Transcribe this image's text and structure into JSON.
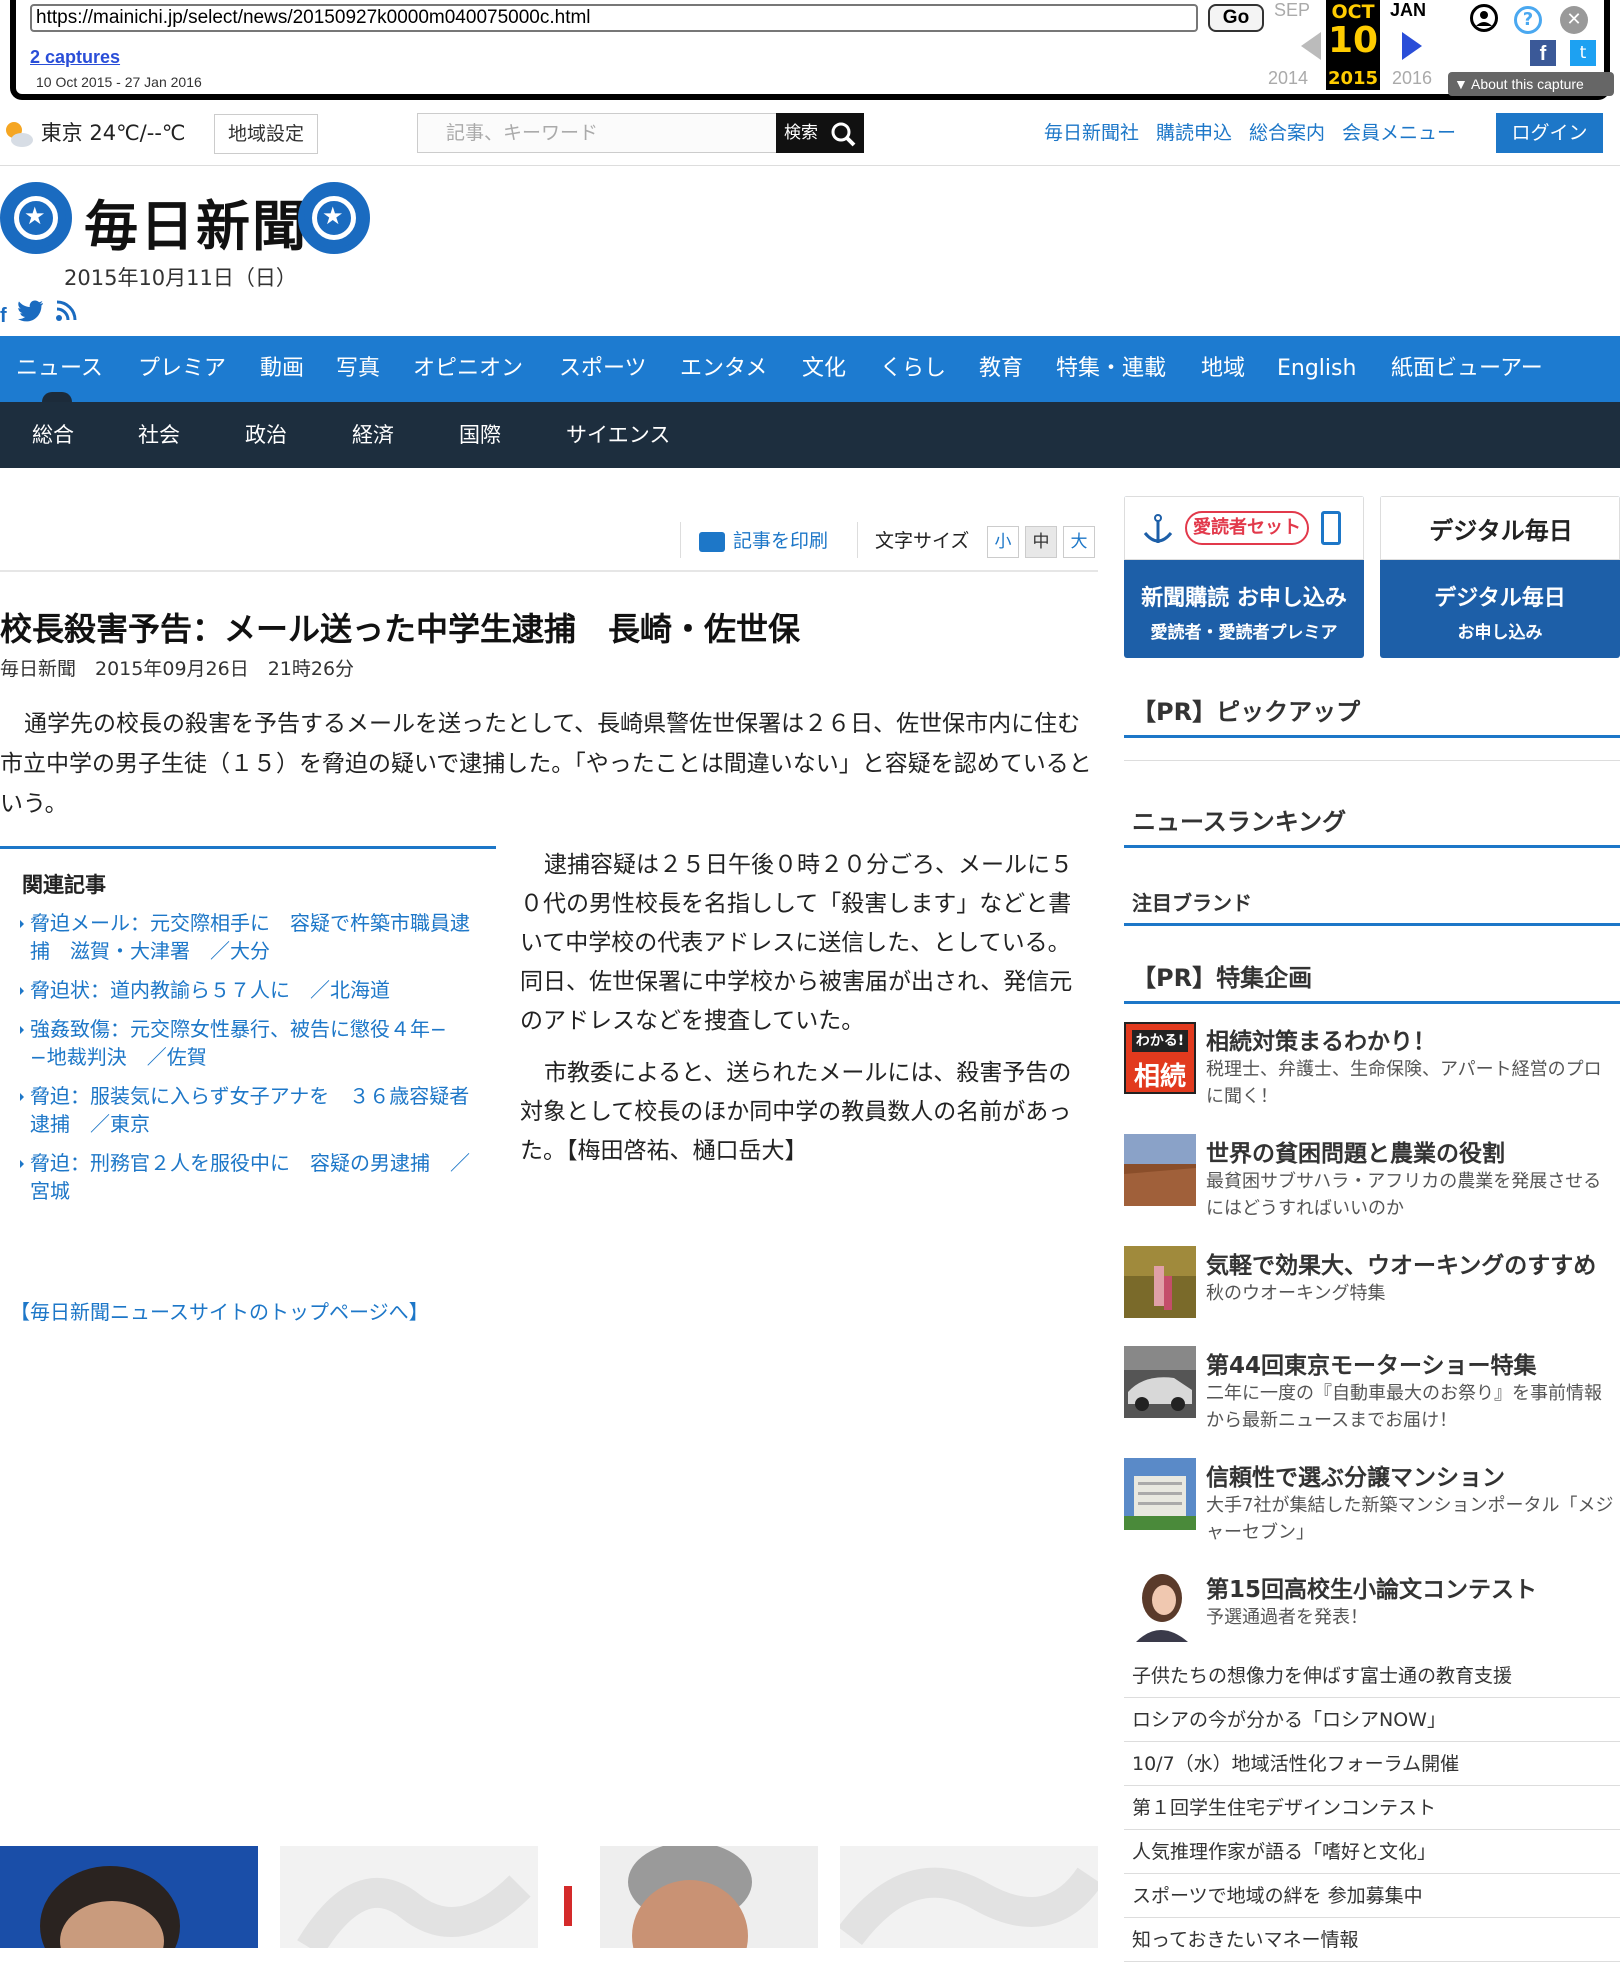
{
  "wayback": {
    "url": "https://mainichi.jp/select/news/20150927k0000m040075000c.html",
    "go_label": "Go",
    "captures_label": "2 captures",
    "range": "10 Oct 2015 - 27 Jan 2016",
    "prev_month": "SEP",
    "prev_year": "2014",
    "cur_month": "OCT",
    "cur_day": "10",
    "cur_year": "2015",
    "next_month": "JAN",
    "next_year": "2016",
    "about_label": "About this capture"
  },
  "topbar": {
    "weather": "東京 24℃/--℃",
    "region_button": "地域設定",
    "search_placeholder": "記事、キーワード",
    "search_button": "検索",
    "links": [
      "毎日新聞社",
      "購読申込",
      "総合案内",
      "会員メニュー"
    ],
    "login": "ログイン"
  },
  "brand": {
    "name": "毎日新聞",
    "date": "2015年10月11日（日）"
  },
  "nav": {
    "items": [
      "ニュース",
      "プレミア",
      "動画",
      "写真",
      "オピニオン",
      "スポーツ",
      "エンタメ",
      "文化",
      "くらし",
      "教育",
      "特集・連載",
      "地域",
      "English",
      "紙面ビューアー"
    ],
    "subitems": [
      "総合",
      "社会",
      "政治",
      "経済",
      "国際",
      "サイエンス"
    ]
  },
  "tools": {
    "print": "記事を印刷",
    "font_size_label": "文字サイズ",
    "sizes": [
      "小",
      "中",
      "大"
    ]
  },
  "article": {
    "title": "校長殺害予告：メール送った中学生逮捕　長崎・佐世保",
    "byline": "毎日新聞　2015年09月26日　21時26分",
    "lead": "通学先の校長の殺害を予告するメールを送ったとして、長崎県警佐世保署は２６日、佐世保市内に住む市立中学の男子生徒（１５）を脅迫の疑いで逮捕した。「やったことは間違いない」と容疑を認めているという。",
    "paragraphs": [
      "逮捕容疑は２５日午後０時２０分ごろ、メールに５０代の男性校長を名指しして「殺害します」などと書いて中学校の代表アドレスに送信した、としている。同日、佐世保署に中学校から被害届が出され、発信元のアドレスなどを捜査していた。",
      "市教委によると、送られたメールには、殺害予告の対象として校長のほか同中学の教員数人の名前があった。【梅田啓祐、樋口岳大】"
    ],
    "related_heading": "関連記事",
    "related": [
      "脅迫メール：元交際相手に　容疑で杵築市職員逮捕　滋賀・大津署　／大分",
      "脅迫状：道内教諭ら５７人に　／北海道",
      "強姦致傷：元交際女性暴行、被告に懲役４年−−地裁判決　／佐賀",
      "脅迫：服装気に入らず女子アナを　３６歳容疑者逮捕　／東京",
      "脅迫：刑務官２人を服役中に　容疑の男逮捕　／宮城"
    ],
    "top_link": "【毎日新聞ニュースサイトのトップページへ】"
  },
  "sidebar": {
    "banner1_top": "愛読者セット",
    "banner1_title": "新聞購読 お申し込み",
    "banner1_sub": "愛読者・愛読者プレミア",
    "banner2_top": "デジタル毎日",
    "banner2_title": "デジタル毎日",
    "banner2_sub": "お申し込み",
    "pickup": "【PR】ピックアップ",
    "ranking": "ニュースランキング",
    "brand": "注目ブランド",
    "special": "【PR】特集企画",
    "thumb_badge": "わかる!",
    "thumb_badge2": "相続",
    "pr_items": [
      {
        "title": "相続対策まるわかり！",
        "desc": "税理士、弁護士、生命保険、アパート経営のプロに聞く！"
      },
      {
        "title": "世界の貧困問題と農業の役割",
        "desc": "最貧困サブサハラ・アフリカの農業を発展させるにはどうすればいいのか"
      },
      {
        "title": "気軽で効果大、ウオーキングのすすめ",
        "desc": "秋のウオーキング特集"
      },
      {
        "title": "第44回東京モーターショー特集",
        "desc": "二年に一度の『自動車最大のお祭り』を事前情報から最新ニュースまでお届け！"
      },
      {
        "title": "信頼性で選ぶ分譲マンション",
        "desc": "大手7社が集結した新築マンションポータル「メジャーセブン」"
      },
      {
        "title": "第15回高校生小論文コンテスト",
        "desc": "予選通過者を発表！"
      }
    ],
    "links": [
      "子供たちの想像力を伸ばす富士通の教育支援",
      "ロシアの今が分かる「ロシアNOW」",
      "10/7（水）地域活性化フォーラム開催",
      "第１回学生住宅デザインコンテスト",
      "人気推理作家が語る「嗜好と文化」",
      "スポーツで地域の絆を 参加募集中",
      "知っておきたいマネー情報"
    ]
  }
}
